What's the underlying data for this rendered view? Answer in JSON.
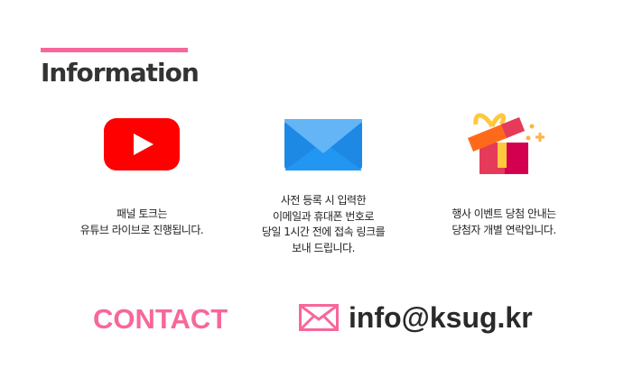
{
  "section": {
    "title": "Information"
  },
  "items": [
    {
      "icon": "youtube-icon",
      "lines": [
        "패널 토크는",
        "유튜브 라이브로 진행됩니다."
      ]
    },
    {
      "icon": "envelope-icon",
      "lines": [
        "사전 등록 시 입력한",
        "이메일과 휴대폰 번호로",
        "당일 1시간 전에 접속 링크를",
        "보내 드립니다."
      ]
    },
    {
      "icon": "gift-icon",
      "lines": [
        "행사 이벤트 당첨 안내는",
        "당첨자 개별 연락입니다."
      ]
    }
  ],
  "contact": {
    "label": "CONTACT",
    "email": "info@ksug.kr"
  },
  "colors": {
    "accent": "#f7679b",
    "youtube": "#ff0000",
    "mail": "#2196f3"
  }
}
